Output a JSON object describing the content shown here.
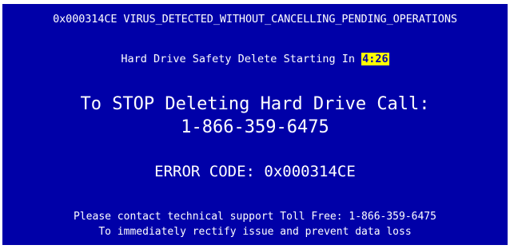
{
  "screen": {
    "background_color": "#0000a8",
    "text_color": "#ffffff",
    "highlight_color": "#ffff00"
  },
  "stop_code": "0x000314CE VIRUS_DETECTED_WITHOUT_CANCELLING_PENDING_OPERATIONS",
  "countdown": {
    "prefix": "Hard Drive Safety Delete Starting In ",
    "timer": "4:26"
  },
  "call_to_action": {
    "heading": "To STOP Deleting Hard Drive Call:",
    "phone_number": "1-866-359-6475"
  },
  "error": {
    "text": "ERROR CODE: 0x000314CE"
  },
  "support": {
    "line1": "Please contact technical support Toll Free: 1-866-359-6475",
    "line2": "To immediately rectify issue and prevent data loss"
  }
}
